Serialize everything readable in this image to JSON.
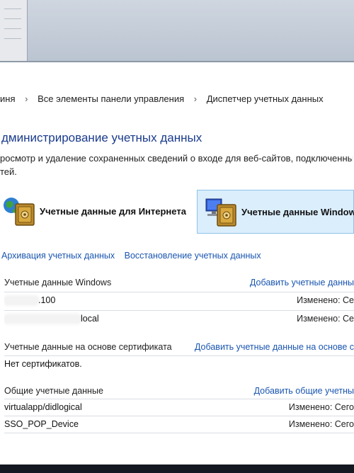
{
  "breadcrumb": {
    "items": [
      "иня",
      "Все элементы панели управления",
      "Диспетчер учетных данных"
    ]
  },
  "page": {
    "title": "дминистрирование учетных данных",
    "description_line1": "росмотр и удаление сохраненных сведений о входе для веб-сайтов, подключенных при",
    "description_line2": "тей."
  },
  "tiles": {
    "web": "Учетные данные для Интернета",
    "windows": "Учетные данные Windows"
  },
  "links": {
    "backup": "Архивация учетных данных",
    "restore": "Восстановление учетных данных"
  },
  "windows_creds": {
    "header": "Учетные данные Windows",
    "add": "Добавить учетные данны",
    "items": [
      {
        "name": ".100",
        "modified": "Изменено:  Се"
      },
      {
        "name": "local",
        "modified": "Изменено:  Се"
      }
    ]
  },
  "cert_creds": {
    "header": "Учетные данные на основе сертификата",
    "add": "Добавить учетные данные на основе с",
    "empty": "Нет сертификатов."
  },
  "generic_creds": {
    "header": "Общие учетные данные",
    "add": "Добавить общие учетны",
    "items": [
      {
        "name": "virtualapp/didlogical",
        "modified": "Изменено:  Сего"
      },
      {
        "name": "SSO_POP_Device",
        "modified": "Изменено:  Сего"
      }
    ]
  },
  "colors": {
    "link": "#1a56b0",
    "title": "#1a3b8c",
    "tile_selected_bg": "#dbeefc"
  }
}
